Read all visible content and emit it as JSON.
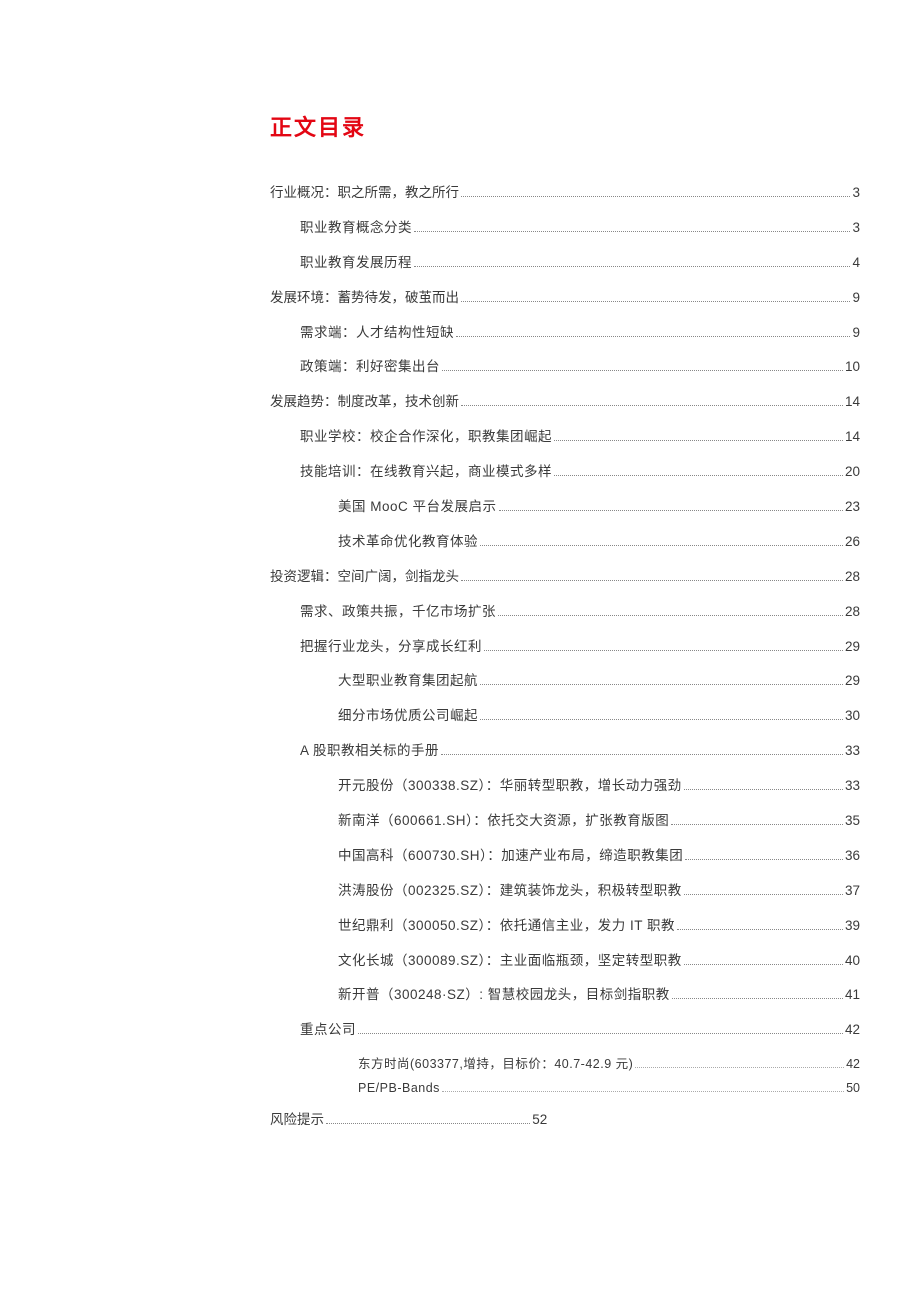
{
  "heading": "正文目录",
  "toc": [
    {
      "level": 1,
      "title": "行业概况：职之所需，教之所行",
      "page": "3",
      "children": [
        {
          "level": 2,
          "title": "职业教育概念分类",
          "page": "3"
        },
        {
          "level": 2,
          "title": "职业教育发展历程",
          "page": "4"
        }
      ]
    },
    {
      "level": 1,
      "title": "发展环境：蓄势待发，破茧而出",
      "page": "9",
      "children": [
        {
          "level": 2,
          "title": "需求端：人才结构性短缺",
          "page": "9"
        },
        {
          "level": 2,
          "title": "政策端：利好密集出台",
          "page": "10"
        }
      ]
    },
    {
      "level": 1,
      "title": "发展趋势：制度改革，技术创新",
      "page": "14",
      "children": [
        {
          "level": 2,
          "title": "职业学校：校企合作深化，职教集团崛起",
          "page": "14"
        },
        {
          "level": 2,
          "title": "技能培训：在线教育兴起，商业模式多样",
          "page": "20",
          "children": [
            {
              "level": 3,
              "title": "美国 MooC 平台发展启示",
              "page": "23"
            },
            {
              "level": 3,
              "title": "技术革命优化教育体验",
              "page": "26"
            }
          ]
        }
      ]
    },
    {
      "level": 1,
      "title": "投资逻辑：空间广阔，剑指龙头",
      "page": "28",
      "children": [
        {
          "level": 2,
          "title": "需求、政策共振，千亿市场扩张",
          "page": "28"
        },
        {
          "level": 2,
          "title": "把握行业龙头，分享成长红利",
          "page": "29",
          "children": [
            {
              "level": 3,
              "title": "大型职业教育集团起航",
              "page": "29"
            },
            {
              "level": 3,
              "title": "细分市场优质公司崛起",
              "page": "30"
            }
          ]
        },
        {
          "level": 2,
          "title": "A 股职教相关标的手册",
          "page": "33",
          "children": [
            {
              "level": 3,
              "title": "开元股份（300338.SZ）：华丽转型职教，增长动力强劲",
              "page": "33"
            },
            {
              "level": 3,
              "title": "新南洋（600661.SH）：依托交大资源，扩张教育版图",
              "page": "35"
            },
            {
              "level": 3,
              "title": "中国高科（600730.SH）：加速产业布局，缔造职教集团",
              "page": "36"
            },
            {
              "level": 3,
              "title": "洪涛股份（002325.SZ）：建筑装饰龙头，积极转型职教",
              "page": "37"
            },
            {
              "level": 3,
              "title": "世纪鼎利（300050.SZ）：依托通信主业，发力 IT 职教",
              "page": "39"
            },
            {
              "level": 3,
              "title": "文化长城（300089.SZ）：主业面临瓶颈，坚定转型职教",
              "page": "40"
            },
            {
              "level": 3,
              "title": "新开普（300248·SZ）: 智慧校园龙头，目标剑指职教",
              "page": "41"
            }
          ]
        },
        {
          "level": 2,
          "title": "重点公司",
          "page": "42",
          "children": [
            {
              "level": 3,
              "style": "fine",
              "title": "东方时尚(603377,增持，目标价：40.7-42.9 元)",
              "page": "42"
            },
            {
              "level": 3,
              "style": "fine",
              "title": "PE/PB-Bands",
              "page": "50"
            }
          ]
        }
      ]
    },
    {
      "level": 1,
      "title": "风险提示",
      "page": "52",
      "half": true
    }
  ]
}
